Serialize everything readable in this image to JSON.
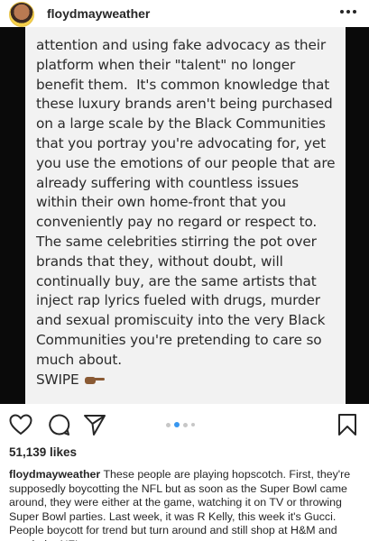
{
  "header": {
    "username": "floydmayweather",
    "more_icon": "more-horizontal-icon"
  },
  "post_image": {
    "lines": [
      "attention and using fake advocacy as their",
      "platform when their \"talent\" no longer",
      "benefit them.  It's common knowledge that",
      "these luxury brands aren't being purchased",
      "on a large scale by the Black Communities",
      "that you portray you're advocating for, yet",
      "you use the emotions of our people that are",
      "already suffering with countless issues",
      "within their own home-front that you",
      "conveniently pay no regard or respect to.",
      "The same celebrities stirring the pot over",
      "brands that they, without doubt, will",
      "continually buy, are the same artists that",
      "inject rap lyrics fueled with drugs, murder",
      "and sexual promiscuity into the very Black",
      "Communities you're pretending to care so",
      "much about."
    ],
    "swipe_label": "SWIPE",
    "swipe_icon": "pointing-hand-icon"
  },
  "actions": {
    "like_icon": "heart-icon",
    "comment_icon": "comment-icon",
    "share_icon": "send-icon",
    "save_icon": "bookmark-icon",
    "carousel_count": 4,
    "carousel_active_index": 1,
    "accent_color": "#3897f0"
  },
  "likes": "51,139 likes",
  "caption": {
    "username": "floydmayweather",
    "text": "These people are playing hopscotch. First, they're supposedly boycotting the NFL but as soon as the Super Bowl came around, they were either at the game, watching it on TV or throwing Super Bowl parties. Last week, it was R Kelly, this week it's Gucci. People boycott for trend but turn around and still shop at H&M and watch the NFL."
  }
}
